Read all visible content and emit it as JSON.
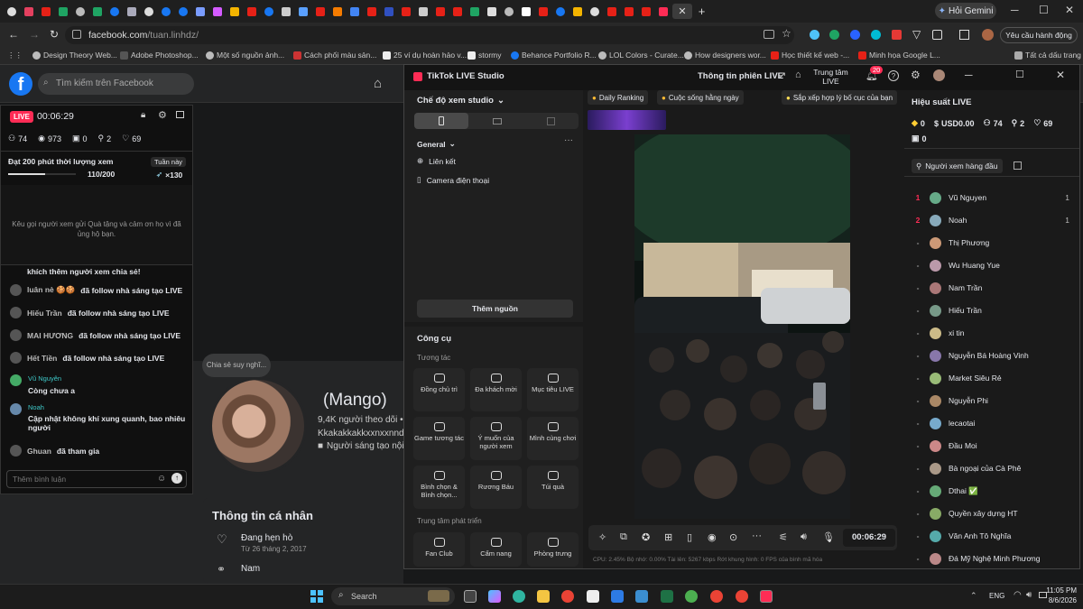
{
  "browser": {
    "gemini_label": "Hỏi Gemini",
    "url_host": "facebook.com",
    "url_path": "/tuan.linhdz/",
    "profile_label": "Yêu cầu hành động",
    "bookmarks": [
      "Design Theory Web...",
      "Adobe Photoshop...",
      "Một số nguồn ảnh...",
      "Cách phối màu sản...",
      "25 ví dụ hoàn hảo v...",
      "stormy",
      "Behance Portfolio R...",
      "LOL Colors - Curate...",
      "How designers wor...",
      "Học thiết kế web -...",
      "Minh họa Google L...",
      "Tất cả dấu trang"
    ]
  },
  "facebook": {
    "search_placeholder": "Tìm kiếm trên Facebook",
    "profile_name": "(Mango)",
    "followers": "9,4K người theo dõi •",
    "username_line": "Kkakakkakkxxnxxnndj",
    "creator_line": "Người sáng tạo nội",
    "thought_bubble": "Chia sẻ suy nghĩ...",
    "intro_title": "Thông tin cá nhân",
    "relationship": "Đang hẹn hò",
    "relationship_date": "Từ 26 tháng 2, 2017",
    "gender": "Nam"
  },
  "live_panel": {
    "live_badge": "LIVE",
    "timer": "00:06:29",
    "stats": {
      "viewers": "74",
      "views": "973",
      "gifts": "0",
      "shares": "2",
      "likes": "69"
    },
    "goal_title": "Đạt 200 phút thời lượng xem",
    "goal_period": "Tuần này",
    "goal_progress_text": "110/200",
    "goal_progress_fraction": 0.55,
    "goal_reward": "×130",
    "gift_hint": "Kêu gọi người xem gửi Quà tặng và cảm ơn họ vì đã ủng hộ bạn.",
    "comments": [
      {
        "name": "",
        "text": "khích thêm người xem chia sẻ!"
      },
      {
        "name": "luân nè 🍪🍪",
        "text": "đã follow nhà sáng tạo LIVE"
      },
      {
        "name": "Hiếu Trần",
        "text": "đã follow nhà sáng tạo LIVE"
      },
      {
        "name": "MAI HƯƠNG",
        "text": "đã follow nhà sáng tạo LIVE"
      },
      {
        "name": "Hết Tiền",
        "text": "đã follow nhà sáng tạo LIVE"
      }
    ],
    "chat": [
      {
        "name": "Vũ Nguyên",
        "text": "Còng chưa a"
      },
      {
        "name": "Noah",
        "text": "Cập nhật không khí xung quanh, bao nhiêu người"
      }
    ],
    "joined_name": "Ghuan",
    "joined_text": "đã tham gia",
    "comment_placeholder": "Thêm bình luận"
  },
  "studio": {
    "app_title": "TikTok LIVE Studio",
    "session_info": "Thông tin phiên LIVE",
    "live_center": "Trung tâm LIVE",
    "notif_count": "20",
    "view_mode": "Chế độ xem studio",
    "general": "General",
    "sources": [
      "Liên kết",
      "Camera điện thoại"
    ],
    "add_source": "Thêm nguồn",
    "tools_title": "Công cụ",
    "interaction": "Tương tác",
    "tools": [
      "Đồng chủ trì",
      "Đa khách mời",
      "Mục tiêu LIVE",
      "Game tương tác",
      "Ý muốn của người xem",
      "Mình cùng chơi",
      "Bình chọn & Bình chọn...",
      "Rương Báu",
      "Túi quà"
    ],
    "dev_center": "Trung tâm phát triển",
    "tools2": [
      "Fan Club",
      "Cẩm nang",
      "Phòng trưng"
    ],
    "chips": [
      "Daily Ranking",
      "Cuộc sống hằng ngày",
      "Sắp xếp hợp lý bố cục của bạn"
    ],
    "control_timer": "00:06:29",
    "status": "CPU: 2.45%    Bộ nhớ: 0.00%    Tài lên: 5267 kbps    Rớt khung hình: 0    FPS của bình mã hóa",
    "perf_title": "Hiệu suất LIVE",
    "perf": {
      "diamonds": "0",
      "usd": "USD0.00",
      "viewers": "74",
      "shares": "2",
      "likes": "69",
      "gifts": "0"
    },
    "top_viewers_label": "Người xem hàng đầu",
    "viewers": [
      {
        "rank": "1",
        "name": "Vũ Nguyen",
        "count": "1"
      },
      {
        "rank": "2",
        "name": "Noah",
        "count": "1"
      },
      {
        "rank": "-",
        "name": "Thị Phương",
        "count": ""
      },
      {
        "rank": "-",
        "name": "Wu Huang Yue",
        "count": ""
      },
      {
        "rank": "-",
        "name": "Nam Trần",
        "count": ""
      },
      {
        "rank": "-",
        "name": "Hiếu Trần",
        "count": ""
      },
      {
        "rank": "-",
        "name": "xi tin",
        "count": ""
      },
      {
        "rank": "-",
        "name": "Nguyễn Bá Hoàng Vinh",
        "count": ""
      },
      {
        "rank": "-",
        "name": "Market Siêu Rẻ",
        "count": ""
      },
      {
        "rank": "-",
        "name": "Nguyễn Phi",
        "count": ""
      },
      {
        "rank": "-",
        "name": "lecaotai",
        "count": ""
      },
      {
        "rank": "-",
        "name": "Đầu Moi",
        "count": ""
      },
      {
        "rank": "-",
        "name": "Bà ngoại của Cà Phê",
        "count": ""
      },
      {
        "rank": "-",
        "name": "Dthai ✅",
        "count": ""
      },
      {
        "rank": "-",
        "name": "Quyền xây dựng HT",
        "count": ""
      },
      {
        "rank": "-",
        "name": "Văn Anh Tô Nghĩa",
        "count": ""
      },
      {
        "rank": "-",
        "name": "Đá Mỹ Nghệ Minh Phương",
        "count": ""
      }
    ]
  },
  "taskbar": {
    "search": "Search",
    "lang": "ENG",
    "time": "11:05 PM",
    "date": "8/6/2026"
  }
}
